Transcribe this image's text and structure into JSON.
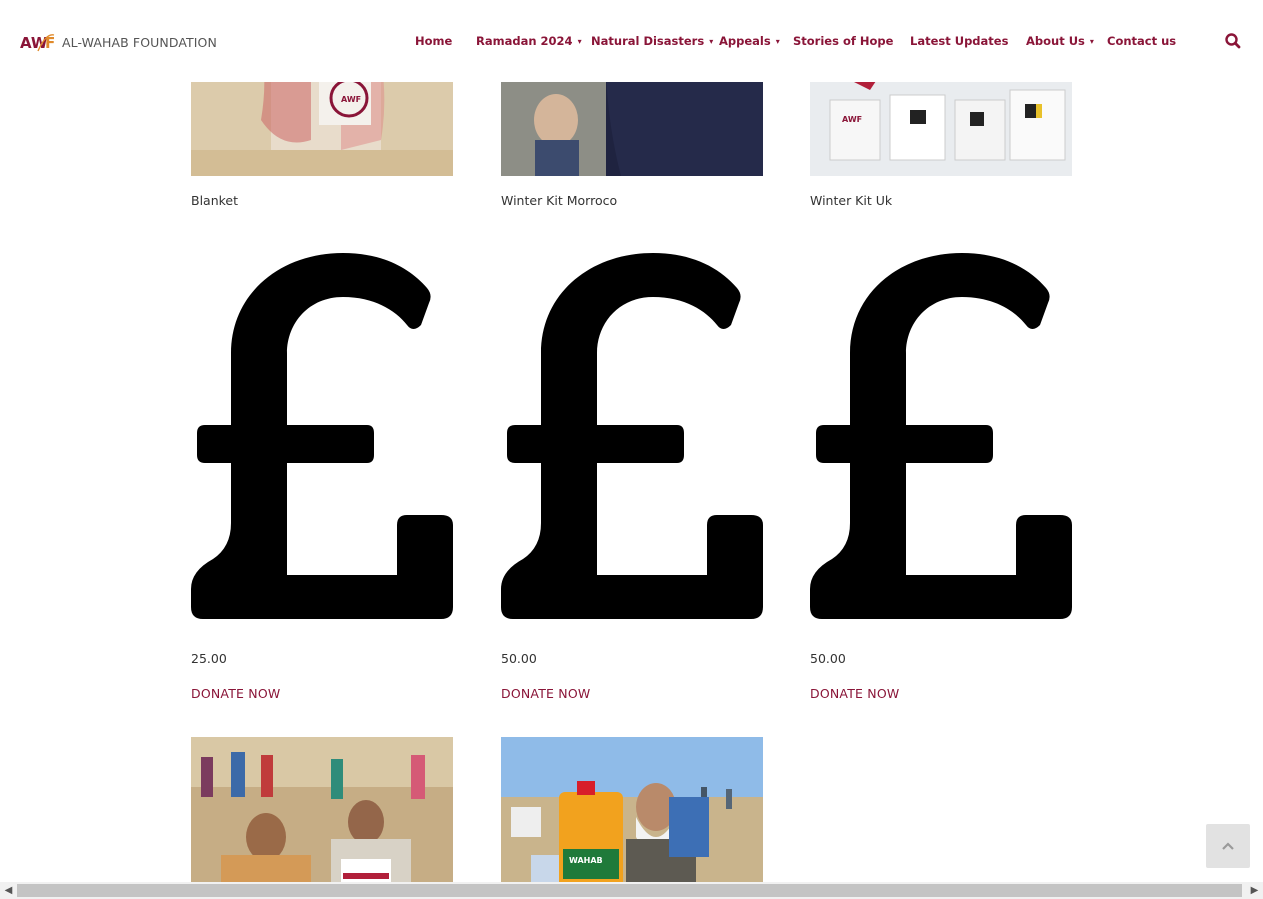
{
  "brand": {
    "logo_mark": "AWF",
    "name": "AL-WAHAB FOUNDATION",
    "primary_color": "#8a1538",
    "accent_color": "#e08a2a"
  },
  "nav": {
    "items": [
      {
        "label": "Home",
        "has_dropdown": false
      },
      {
        "label": "Ramadan 2024",
        "has_dropdown": true
      },
      {
        "label": "Natural Disasters",
        "has_dropdown": true
      },
      {
        "label": "Appeals",
        "has_dropdown": true
      },
      {
        "label": "Stories of Hope",
        "has_dropdown": false
      },
      {
        "label": "Latest Updates",
        "has_dropdown": false
      },
      {
        "label": "About Us",
        "has_dropdown": true
      },
      {
        "label": "Contact us",
        "has_dropdown": false
      }
    ],
    "search_icon": "search-icon"
  },
  "products": {
    "row1": [
      {
        "title": "Blanket",
        "price": "25.00",
        "cta": "DONATE NOW",
        "currency_icon": "pound-sign-icon"
      },
      {
        "title": "Winter Kit Morroco",
        "price": "50.00",
        "cta": "DONATE NOW",
        "currency_icon": "pound-sign-icon"
      },
      {
        "title": "Winter Kit Uk",
        "price": "50.00",
        "cta": "DONATE NOW",
        "currency_icon": "pound-sign-icon"
      }
    ],
    "row2": [
      {
        "image": "men-with-aid-boxes-photo"
      },
      {
        "image": "elder-with-oil-can-photo",
        "image_text": "WAHAB"
      }
    ]
  },
  "controls": {
    "back_to_top_icon": "chevron-up-icon",
    "scroll_left_icon": "chevron-left-icon",
    "scroll_right_icon": "chevron-right-icon"
  }
}
